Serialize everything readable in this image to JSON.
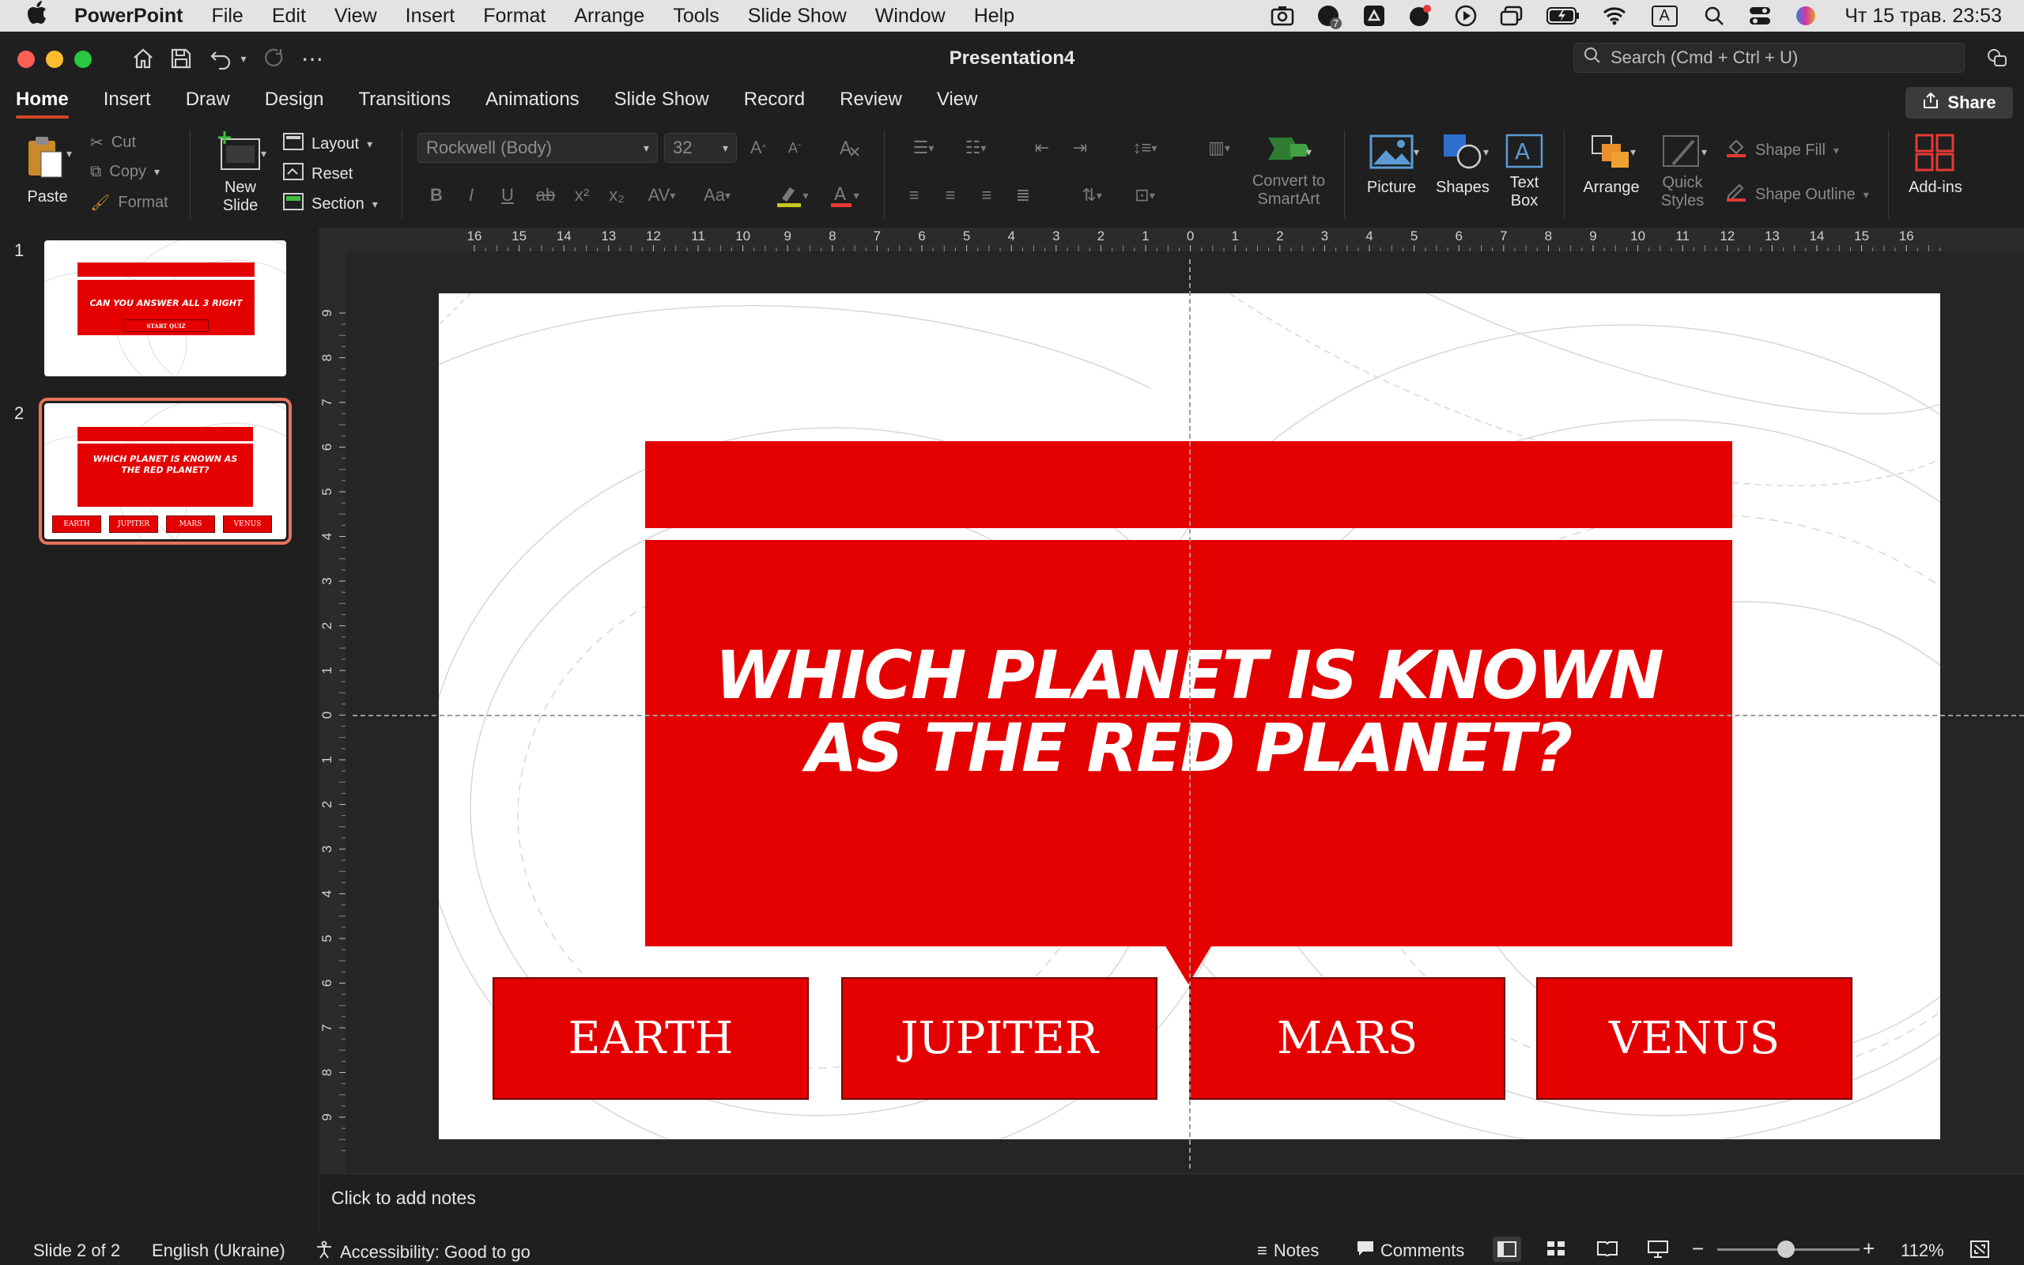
{
  "menubar": {
    "app_name": "PowerPoint",
    "items": [
      "File",
      "Edit",
      "View",
      "Insert",
      "Format",
      "Arrange",
      "Tools",
      "Slide Show",
      "Window",
      "Help"
    ],
    "clock": "Чт 15 трав.  23:53",
    "badge_count": "7",
    "input_source": "A"
  },
  "window": {
    "title": "Presentation4",
    "search_placeholder": "Search (Cmd + Ctrl + U)"
  },
  "tabs": [
    "Home",
    "Insert",
    "Draw",
    "Design",
    "Transitions",
    "Animations",
    "Slide Show",
    "Record",
    "Review",
    "View"
  ],
  "active_tab": "Home",
  "share_label": "Share",
  "ribbon": {
    "paste": "Paste",
    "cut": "Cut",
    "copy": "Copy",
    "format": "Format",
    "new_slide_line1": "New",
    "new_slide_line2": "Slide",
    "layout": "Layout",
    "reset": "Reset",
    "section": "Section",
    "font_name": "Rockwell (Body)",
    "font_size": "32",
    "convert_line1": "Convert to",
    "convert_line2": "SmartArt",
    "picture": "Picture",
    "shapes": "Shapes",
    "textbox_line1": "Text",
    "textbox_line2": "Box",
    "arrange": "Arrange",
    "quick_styles_line1": "Quick",
    "quick_styles_line2": "Styles",
    "shape_fill": "Shape Fill",
    "shape_outline": "Shape Outline",
    "addins": "Add-ins"
  },
  "thumbnails": [
    {
      "number": "1",
      "title": "CAN YOU ANSWER ALL 3 RIGHT",
      "button": "START QUIZ"
    },
    {
      "number": "2",
      "title": "WHICH PLANET IS KNOWN AS THE RED PLANET?",
      "answers": [
        "EARTH",
        "JUPITER",
        "MARS",
        "VENUS"
      ]
    }
  ],
  "ruler": {
    "h_ticks": [
      "16",
      "15",
      "14",
      "13",
      "12",
      "11",
      "10",
      "9",
      "8",
      "7",
      "6",
      "5",
      "4",
      "3",
      "2",
      "1",
      "0",
      "1",
      "2",
      "3",
      "4",
      "5",
      "6",
      "7",
      "8",
      "9",
      "10",
      "11",
      "12",
      "13",
      "14",
      "15",
      "16"
    ],
    "v_ticks": [
      "9",
      "8",
      "7",
      "6",
      "5",
      "4",
      "3",
      "2",
      "1",
      "0",
      "1",
      "2",
      "3",
      "4",
      "5",
      "6",
      "7",
      "8",
      "9"
    ]
  },
  "slide": {
    "question": "WHICH PLANET IS KNOWN AS THE RED PLANET?",
    "answers": [
      "EARTH",
      "JUPITER",
      "MARS",
      "VENUS"
    ],
    "accent_color": "#e50000"
  },
  "notes_placeholder": "Click to add notes",
  "status": {
    "slide_info": "Slide 2 of 2",
    "language": "English (Ukraine)",
    "accessibility": "Accessibility: Good to go",
    "notes": "Notes",
    "comments": "Comments",
    "zoom": "112%"
  },
  "colors": {
    "accent_tab": "#d24726",
    "slide_red": "#e50000",
    "selection": "#e8735a"
  }
}
